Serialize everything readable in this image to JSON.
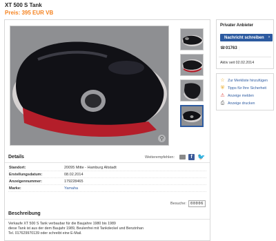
{
  "header": {
    "title": "XT 500 S Tank",
    "price": "Preis: 395 EUR VB"
  },
  "gallery": {
    "thumbnail_count": 4,
    "active_thumbnail": 4
  },
  "details": {
    "title": "Details",
    "share_label": "Weiterempfehlen:",
    "rows": [
      {
        "key": "Standort:",
        "value": "20095 Mitte - Hamburg Altstadt"
      },
      {
        "key": "Erstellungsdatum:",
        "value": "08.02.2014"
      },
      {
        "key": "Anzeigennummer:",
        "value": "179228465"
      },
      {
        "key": "Marke:",
        "value": "Yamaha"
      }
    ],
    "visits_label": "Besuche:",
    "visits_count": "00006"
  },
  "description": {
    "title": "Beschreibung",
    "lines": [
      "Verkaufe XT 500 S Tank verbaubar für die Baujahre 1980 bis 1989",
      "diese Tank ist aus der dem Baujahr 1989, Beulenfrei mit Tankdeckel und Benzinhan",
      "Tel. 017629970139 oder schreibt eine E-Mail."
    ]
  },
  "seller": {
    "title": "Privater Anbieter",
    "message_button": "Nachricht schreiben",
    "phone": "01763",
    "active_since": "Aktiv seit 02.02.2014"
  },
  "actions": [
    {
      "label": "Zur Merkliste hinzufügen",
      "icon": "star-icon"
    },
    {
      "label": "Tipps für Ihre Sicherheit",
      "icon": "shield-icon"
    },
    {
      "label": "Anzeige melden",
      "icon": "warning-icon"
    },
    {
      "label": "Anzeige drucken",
      "icon": "print-icon"
    }
  ],
  "colors": {
    "price": "#f5821f",
    "button": "#2c5aa0",
    "link": "#2c5aa0"
  }
}
